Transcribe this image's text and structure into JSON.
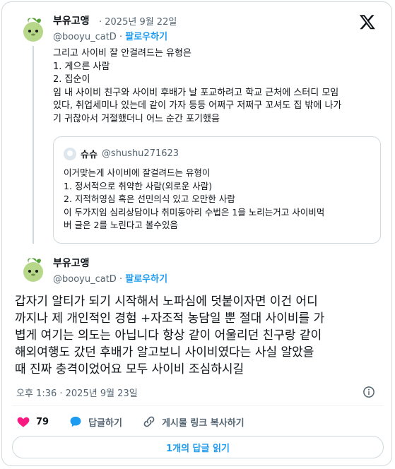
{
  "post1": {
    "author_name": "부유고앵",
    "date": "2025년 9월 22일",
    "handle": "@booyu_catD",
    "follow_label": "팔로우하기",
    "lines": [
      "그리고 사이비 잘 안걸려드는 유형은",
      "1. 게으른 사람",
      "2. 집순이",
      "임  내 사이비 친구와 사이비 후배가 날 포교하려고 학교 근처에 스터디 모임",
      "있다, 취업세미나 있는데 같이 가자 등등 어쩌구 저쩌구 꼬셔도 집 밖에 나가",
      "기 귀찮아서 거절했더니 어느 순간 포기했음"
    ]
  },
  "quote": {
    "author_name": "슈슈",
    "handle": "@shushu271623",
    "lines": [
      "이거맞는게 사이비에 잘걸려드는 유형이",
      "1. 정서적으로 취약한 사람(외로운 사람)",
      "2. 지적허영심 혹은 선민의식 있고 오만한 사람",
      "이 두가지임 심리상담이나 취미동아리 수법은 1을 노리는거고 사이비먹",
      "버 글은 2를 노린다고 볼수있음"
    ]
  },
  "post2": {
    "author_name": "부유고앵",
    "handle": "@booyu_catD",
    "follow_label": "팔로우하기",
    "lines": [
      "갑자기 알티가 되기 시작해서 노파심에 덧붙이자면 이건 어디",
      "까지나 제 개인적인 경험 +자조적 농담일 뿐 절대 사이비를 가",
      "볍게 여기는 의도는 아닙니다 항상 같이 어울리던 친구랑 같이",
      "해외여행도 갔던 후배가 알고보니 사이비였다는 사실 알았을",
      "때 진짜 충격이었어요 모두 사이비 조심하시길"
    ],
    "timestamp": "오후 1:36 · 2025년 9월 23일"
  },
  "actions": {
    "like_count": "79",
    "reply_label": "답글하기",
    "copy_link_label": "게시물 링크 복사하기"
  },
  "read_replies_label": "1개의 답글 읽기",
  "icons": {
    "logo": "x-logo-icon",
    "like": "heart-icon",
    "reply": "speech-bubble-icon",
    "copy": "link-icon",
    "info": "info-icon"
  },
  "colors": {
    "accent": "#1d9bf0",
    "like": "#f91880",
    "text": "#0f1419",
    "muted": "#536471",
    "border": "#cfd9de"
  }
}
